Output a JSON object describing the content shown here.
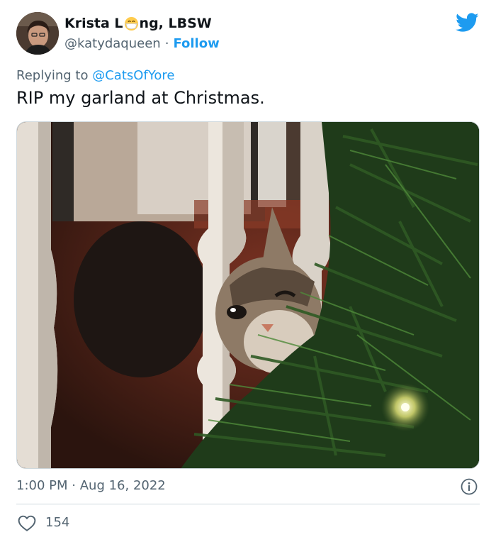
{
  "tweet": {
    "author": {
      "name_prefix": "Krista L",
      "name_suffix": "ng, LBSW",
      "name_emoji": "face-with-medical-mask-emoji",
      "handle": "@katydaqueen",
      "separator": "·",
      "follow_label": "Follow"
    },
    "replying": {
      "label": "Replying to",
      "mention": "@CatsOfYore"
    },
    "text": "RIP my garland at Christmas.",
    "time": "1:00 PM",
    "date": "Aug 16, 2022",
    "likes": "154"
  },
  "icons": {
    "brand": "twitter-bird-icon",
    "info": "info-icon",
    "like": "heart-icon"
  },
  "colors": {
    "accent": "#1d9bf0",
    "text": "#0f1419",
    "secondary": "#536471",
    "border": "#cfd9de"
  }
}
